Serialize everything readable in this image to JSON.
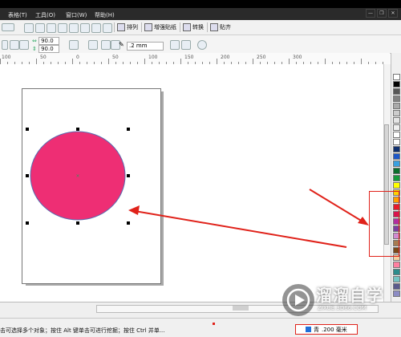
{
  "menu": {
    "items": [
      "表格(T)",
      "工具(O)",
      "窗口(W)",
      "帮助(H)"
    ]
  },
  "toolbar": {
    "text_buttons": [
      {
        "label": "排列"
      },
      {
        "label": "增强贴纸"
      },
      {
        "label": "转换"
      },
      {
        "label": "贴齐"
      }
    ]
  },
  "property_bar": {
    "width_value": "90.0",
    "height_value": "90.0",
    "outline_width": ".2 mm"
  },
  "ruler": {
    "tick_labels": [
      "100",
      "50",
      "0",
      "50",
      "100",
      "150",
      "200",
      "250",
      "300"
    ]
  },
  "palette": {
    "colors": [
      "#ffffff",
      "#000000",
      "#555555",
      "#808080",
      "#aaaaaa",
      "#cccccc",
      "#e5e5e5",
      "#f0f0f0",
      "#ffffff",
      "#ffffff",
      "#10306e",
      "#1d57c8",
      "#3aa0e0",
      "#0b6e2c",
      "#169a3b",
      "#ffff00",
      "#ffd200",
      "#ff9f00",
      "#e8192c",
      "#d9144e",
      "#b02fa0",
      "#7a3fa0",
      "#d08ad0",
      "#a67c52",
      "#7a4a1a",
      "#f5d0a0",
      "#ff7fa0",
      "#2c8c8c",
      "#74c4c4",
      "#5a5a8c",
      "#8c8cc4"
    ]
  },
  "canvas": {
    "ellipse_color": "#ee2e74",
    "ellipse_stroke": "#5a6bb0",
    "arrow_color": "#e0221a"
  },
  "status": {
    "text": "击可选择多个对象；按住 Alt 键单击可进行挖掘；按住 Ctrl 并单...",
    "fill_label": "青",
    "fill_value": ".200 毫米"
  },
  "watermark": {
    "title": "溜溜自学",
    "subtitle": "ZIXUE.3D66.COM"
  },
  "window": {
    "controls": [
      "—",
      "❐",
      "✕"
    ]
  }
}
